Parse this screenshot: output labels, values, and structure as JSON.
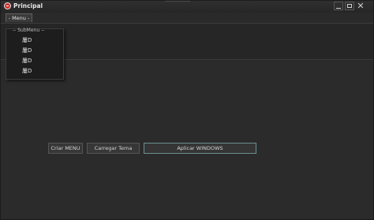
{
  "window": {
    "title": "Principal",
    "minimize_label": "_",
    "maximize_label": "□",
    "close_label": "✕"
  },
  "menubar": {
    "menu_label": "- Menu -"
  },
  "submenu": {
    "header": "-- SubMenu --",
    "items": [
      "屢D",
      "屢D",
      "屢D",
      "屢D"
    ]
  },
  "buttons": {
    "criar": "Criar MENU",
    "carregar": "Carregar Tema",
    "aplicar": "Aplicar WINDOWS"
  },
  "icons": {
    "app": "app-logo-icon",
    "accent": "#d13030"
  }
}
